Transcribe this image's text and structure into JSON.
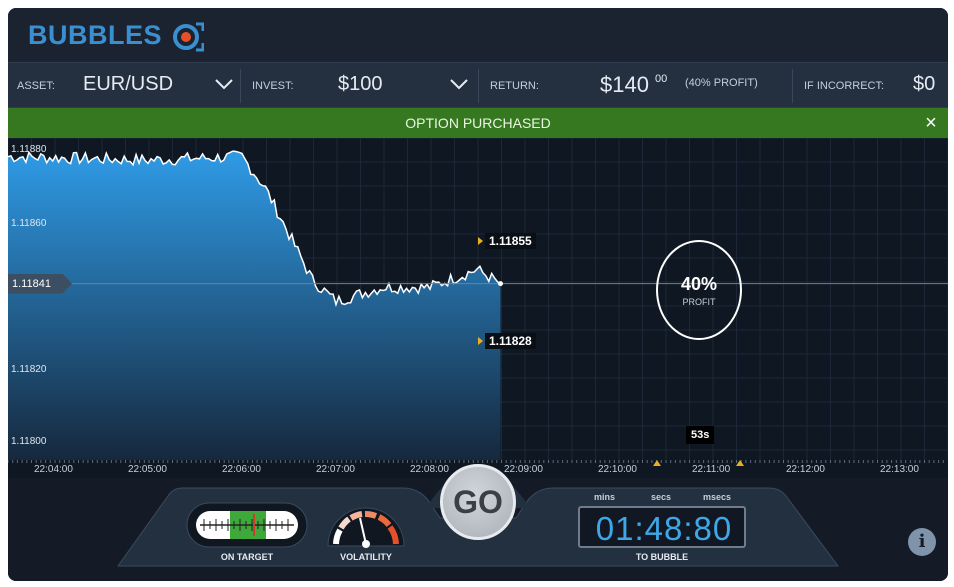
{
  "brand": {
    "name": "BUBBLES"
  },
  "bar": {
    "asset_label": "ASSET:",
    "asset_value": "EUR/USD",
    "invest_label": "INVEST:",
    "invest_value": "$100",
    "return_label": "RETURN:",
    "return_value": "$140",
    "return_cents": "00",
    "return_profit": "(40% PROFIT)",
    "incorrect_label": "IF INCORRECT:",
    "incorrect_value": "$0"
  },
  "banner": {
    "text": "OPTION PURCHASED",
    "close": "×"
  },
  "chart": {
    "y_labels": [
      "1.11880",
      "1.11860",
      "1.11841",
      "1.11820",
      "1.11800"
    ],
    "upper_target": "1.11855",
    "lower_target": "1.11828",
    "profit_pct": "40%",
    "profit_label": "PROFIT",
    "seconds_badge": "53s",
    "time_labels": [
      "22:04:00",
      "22:05:00",
      "22:06:00",
      "22:07:00",
      "22:08:00",
      "22:09:00",
      "22:10:00",
      "22:11:00",
      "22:12:00",
      "22:13:00"
    ]
  },
  "chart_data": {
    "type": "area",
    "title": "",
    "ylabel": "",
    "xlabel": "",
    "ylim": [
      1.11795,
      1.1188
    ],
    "x": [
      "22:04:00",
      "22:05:00",
      "22:06:00",
      "22:06:15",
      "22:06:45",
      "22:07:00",
      "22:07:30",
      "22:08:00",
      "22:08:30",
      "22:08:45"
    ],
    "series": [
      {
        "values": [
          1.11877,
          1.11876,
          1.11877,
          1.11868,
          1.11842,
          1.11836,
          1.1184,
          1.1184,
          1.11845,
          1.11841
        ]
      }
    ],
    "current": 1.11841,
    "grid": true,
    "colors": {
      "fill_top": "#2f9be6",
      "fill_bottom": "#16283d",
      "line": "#ffffff"
    }
  },
  "controls": {
    "on_target_label": "ON TARGET",
    "volatility_label": "VOLATILITY",
    "go_label": "GO",
    "timer_mins_label": "mins",
    "timer_secs_label": "secs",
    "timer_msecs_label": "msecs",
    "timer_value": "01:48:80",
    "to_bubble_label": "TO BUBBLE",
    "info": "i"
  }
}
